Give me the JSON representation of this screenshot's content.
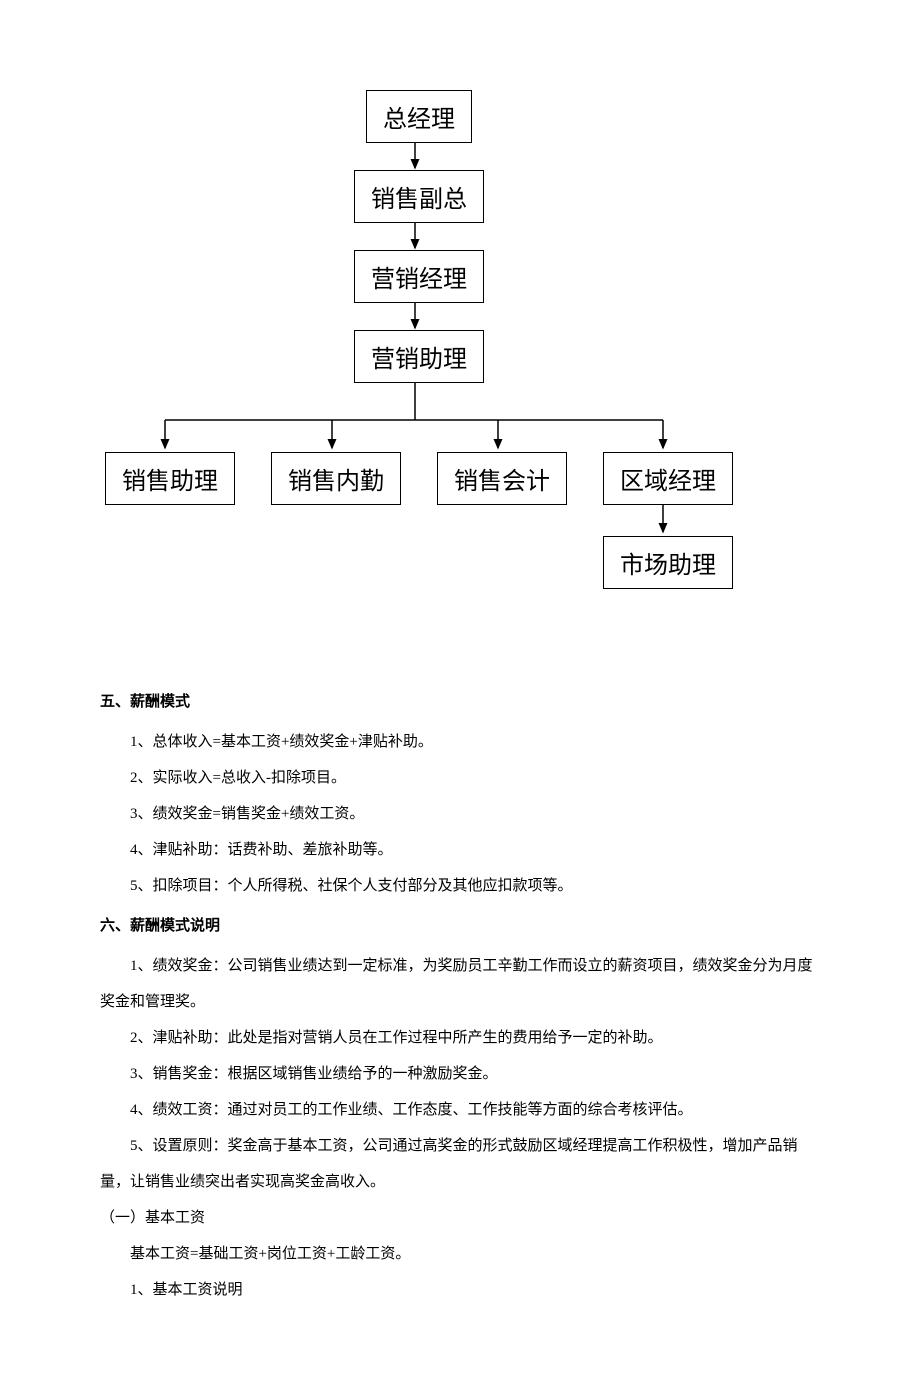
{
  "chart_data": {
    "type": "tree",
    "nodes": {
      "n1": "总经理",
      "n2": "销售副总",
      "n3": "营销经理",
      "n4": "营销助理",
      "n5": "销售助理",
      "n6": "销售内勤",
      "n7": "销售会计",
      "n8": "区域经理",
      "n9": "市场助理"
    },
    "edges": [
      [
        "n1",
        "n2"
      ],
      [
        "n2",
        "n3"
      ],
      [
        "n3",
        "n4"
      ],
      [
        "n4",
        "n5"
      ],
      [
        "n4",
        "n6"
      ],
      [
        "n4",
        "n7"
      ],
      [
        "n4",
        "n8"
      ],
      [
        "n8",
        "n9"
      ]
    ]
  },
  "section5": {
    "title": "五、薪酬模式",
    "items": [
      "1、总体收入=基本工资+绩效奖金+津贴补助。",
      "2、实际收入=总收入-扣除项目。",
      "3、绩效奖金=销售奖金+绩效工资。",
      "4、津贴补助：话费补助、差旅补助等。",
      "5、扣除项目：个人所得税、社保个人支付部分及其他应扣款项等。"
    ]
  },
  "section6": {
    "title": "六、薪酬模式说明",
    "items": [
      "1、绩效奖金：公司销售业绩达到一定标准，为奖励员工辛勤工作而设立的薪资项目，绩效奖金分为月度奖金和管理奖。",
      "2、津贴补助：此处是指对营销人员在工作过程中所产生的费用给予一定的补助。",
      "3、销售奖金：根据区域销售业绩给予的一种激励奖金。",
      "4、绩效工资：通过对员工的工作业绩、工作态度、工作技能等方面的综合考核评估。",
      "5、设置原则：奖金高于基本工资，公司通过高奖金的形式鼓励区域经理提高工作积极性，增加产品销量，让销售业绩突出者实现高奖金高收入。"
    ]
  },
  "sub1": {
    "title": "（一）基本工资",
    "formula": "基本工资=基础工资+岗位工资+工龄工资。",
    "item1": "1、基本工资说明"
  }
}
